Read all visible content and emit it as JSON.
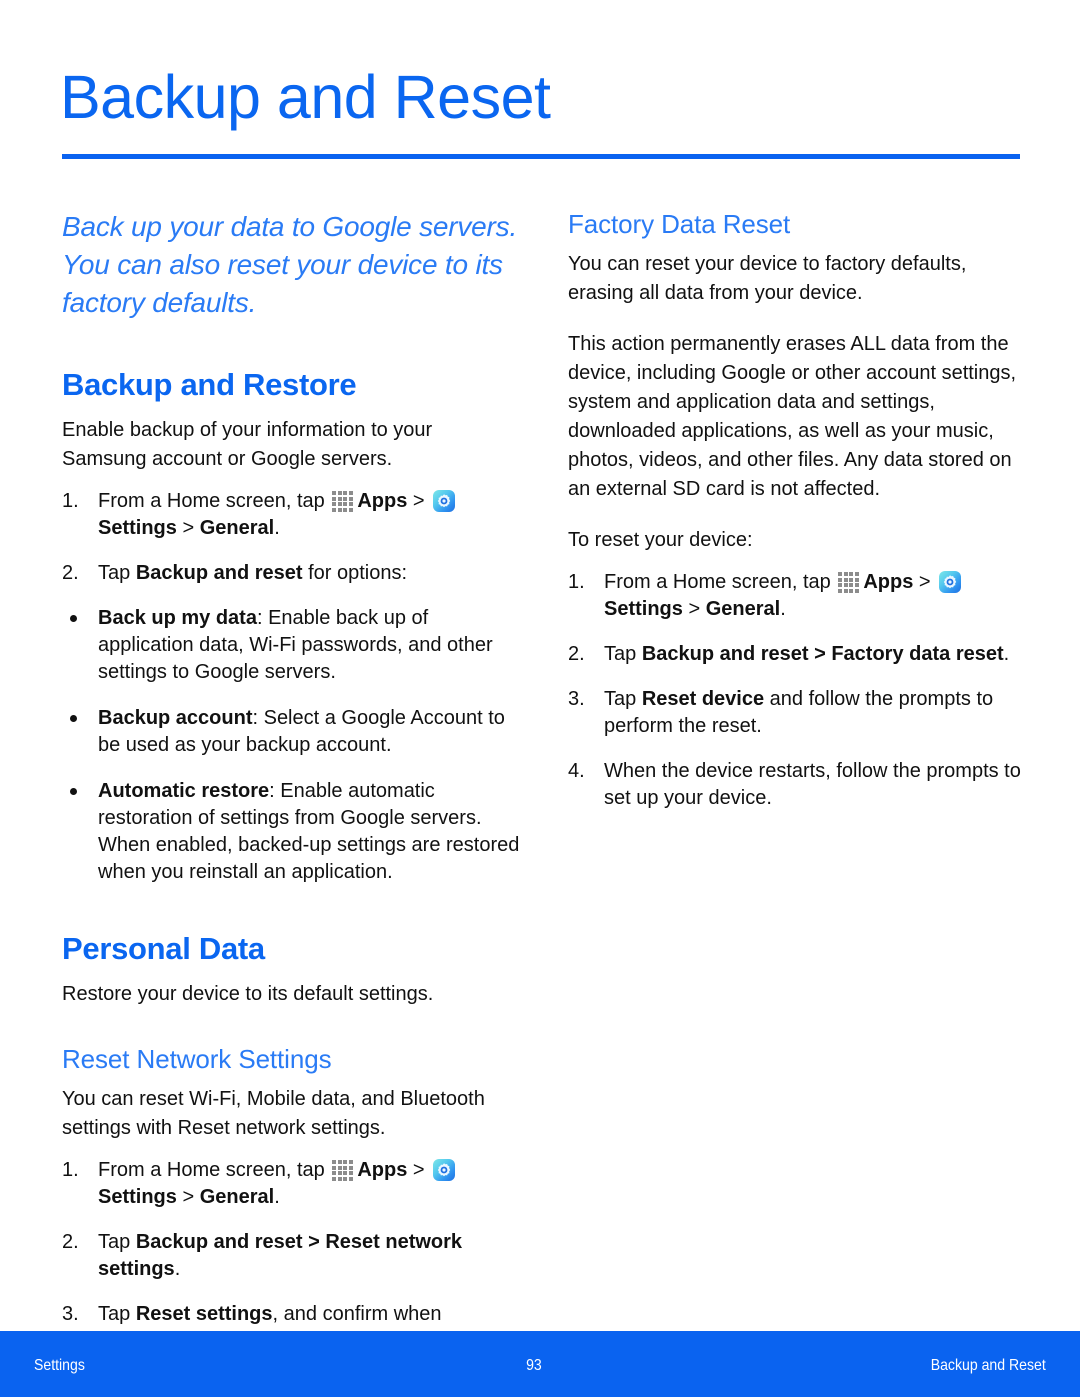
{
  "document": {
    "title": "Backup and Reset",
    "accent_color": "#0a66f0",
    "subheading_color": "#2a7bf5"
  },
  "left_column": {
    "lede": "Back up your data to Google servers. You can also reset your device to its factory defaults.",
    "backup_restore": {
      "heading": "Backup and Restore",
      "intro": "Enable backup of your information to your Samsung account or Google servers.",
      "steps": [
        {
          "num": "1.",
          "parts": [
            {
              "t": "From a Home screen, tap ",
              "b": false
            },
            {
              "icon": "apps-grid-icon"
            },
            {
              "t": "Apps",
              "b": true
            },
            {
              "t": " > ",
              "b": false
            },
            {
              "icon": "settings-gear-icon"
            },
            {
              "t": "Settings",
              "b": true
            },
            {
              "t": " > ",
              "b": false
            },
            {
              "t": "General",
              "b": true
            },
            {
              "t": ".",
              "b": false
            }
          ]
        },
        {
          "num": "2.",
          "parts": [
            {
              "t": "Tap ",
              "b": false
            },
            {
              "t": "Backup and reset",
              "b": true
            },
            {
              "t": " for options:",
              "b": false
            }
          ]
        }
      ],
      "bullets": [
        {
          "term": "Back up my data",
          "desc": ": Enable back up of application data, Wi-Fi passwords, and other settings to Google servers."
        },
        {
          "term": "Backup account",
          "desc": ": Select a Google Account to be used as your backup account."
        },
        {
          "term": "Automatic restore",
          "desc": ": Enable automatic restoration of settings from Google servers. When enabled, backed-up settings are restored when you reinstall an application."
        }
      ]
    },
    "personal_data": {
      "heading": "Personal Data",
      "intro": "Restore your device to its default settings.",
      "reset_network": {
        "heading": "Reset Network Settings",
        "intro": "You can reset Wi-Fi, Mobile data, and Bluetooth settings with Reset network settings.",
        "steps": [
          {
            "num": "1.",
            "parts": [
              {
                "t": "From a Home screen, tap ",
                "b": false
              },
              {
                "icon": "apps-grid-icon"
              },
              {
                "t": "Apps",
                "b": true
              },
              {
                "t": " > ",
                "b": false
              },
              {
                "icon": "settings-gear-icon"
              },
              {
                "t": "Settings",
                "b": true
              },
              {
                "t": " > ",
                "b": false
              },
              {
                "t": "General",
                "b": true
              },
              {
                "t": ".",
                "b": false
              }
            ]
          },
          {
            "num": "2.",
            "parts": [
              {
                "t": "Tap ",
                "b": false
              },
              {
                "t": "Backup and reset > Reset network settings",
                "b": true
              },
              {
                "t": ".",
                "b": false
              }
            ]
          },
          {
            "num": "3.",
            "parts": [
              {
                "t": "Tap ",
                "b": false
              },
              {
                "t": "Reset settings",
                "b": true
              },
              {
                "t": ", and confirm when prompted.",
                "b": false
              }
            ]
          }
        ]
      }
    }
  },
  "right_column": {
    "factory_data_reset": {
      "heading": "Factory Data Reset",
      "paragraphs": [
        "You can reset your device to factory defaults, erasing all data from your device.",
        "This action permanently erases ALL data from the device, including Google or other account settings, system and application data and settings, downloaded applications, as well as your music, photos, videos, and other files. Any data stored on an external SD card is not affected.",
        "To reset your device:"
      ],
      "steps": [
        {
          "num": "1.",
          "parts": [
            {
              "t": "From a Home screen, tap ",
              "b": false
            },
            {
              "icon": "apps-grid-icon"
            },
            {
              "t": "Apps",
              "b": true
            },
            {
              "t": " > ",
              "b": false
            },
            {
              "icon": "settings-gear-icon"
            },
            {
              "t": "Settings",
              "b": true
            },
            {
              "t": " > ",
              "b": false
            },
            {
              "t": "General",
              "b": true
            },
            {
              "t": ".",
              "b": false
            }
          ]
        },
        {
          "num": "2.",
          "parts": [
            {
              "t": "Tap ",
              "b": false
            },
            {
              "t": "Backup and reset > Factory data reset",
              "b": true
            },
            {
              "t": ".",
              "b": false
            }
          ]
        },
        {
          "num": "3.",
          "parts": [
            {
              "t": "Tap ",
              "b": false
            },
            {
              "t": "Reset device",
              "b": true
            },
            {
              "t": " and follow the prompts to perform the reset.",
              "b": false
            }
          ]
        },
        {
          "num": "4.",
          "parts": [
            {
              "t": "When the device restarts, follow the prompts to set up your device.",
              "b": false
            }
          ]
        }
      ]
    }
  },
  "footer": {
    "left": "Settings",
    "page_number": "93",
    "right": "Backup and Reset",
    "background_color": "#0a63f0"
  }
}
